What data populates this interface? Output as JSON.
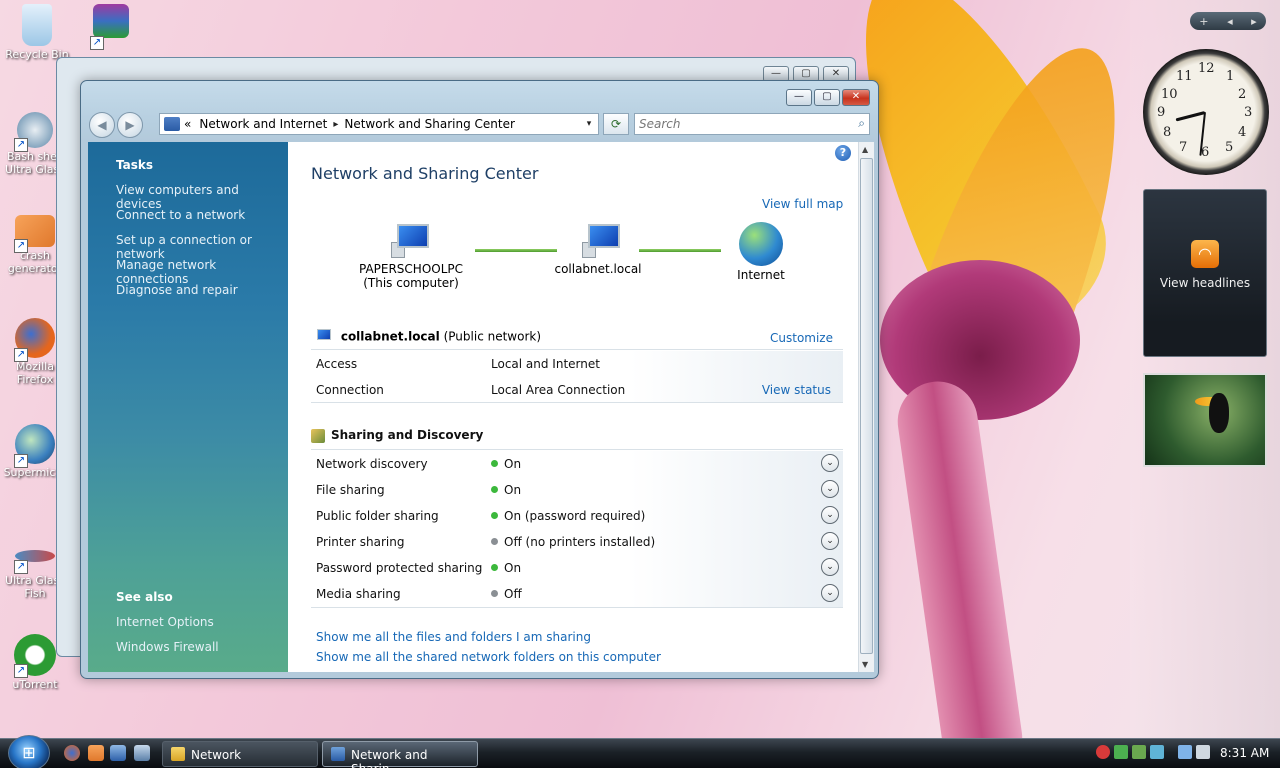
{
  "desktop": {
    "icons": [
      {
        "label": "Recycle Bin",
        "color": "#9cc7e6"
      },
      {
        "label": "",
        "color": "#7a2c7c"
      },
      {
        "label": "Bash shell Ultra Glass",
        "color": "#5b86a8"
      },
      {
        "label": "crash generator",
        "color": "#e0782c"
      },
      {
        "label": "Mozilla Firefox",
        "color": "#e5661d"
      },
      {
        "label": "Supermicro",
        "color": "#3a7fbf"
      },
      {
        "label": "Ultra Glass Fish",
        "color": "#4b8bc2"
      },
      {
        "label": "uTorrent",
        "color": "#2c9b34"
      }
    ]
  },
  "window": {
    "caption_buttons": {
      "minimize": "—",
      "maximize": "▢",
      "close": "✕"
    },
    "nav": {
      "back": "◀",
      "forward": "▶"
    },
    "address": {
      "prefix": "«",
      "segments": [
        "Network and Internet",
        "Network and Sharing Center"
      ],
      "separator": "▸",
      "dropdown": "▾",
      "refresh": "⟳"
    },
    "search": {
      "placeholder": "Search",
      "icon": "magnifier-icon",
      "glyph": "⌕"
    }
  },
  "sidebar": {
    "tasks_heading": "Tasks",
    "tasks": [
      "View computers and devices",
      "Connect to a network",
      "Set up a connection or network",
      "Manage network connections",
      "Diagnose and repair"
    ],
    "see_also_heading": "See also",
    "see_also": [
      "Internet Options",
      "Windows Firewall"
    ]
  },
  "main": {
    "help": "?",
    "title": "Network and Sharing Center",
    "view_full_map": "View full map",
    "map": {
      "computer": {
        "name": "PAPERSCHOOLPC",
        "sub": "(This computer)"
      },
      "network": {
        "name": "collabnet.local"
      },
      "internet": {
        "name": "Internet"
      }
    },
    "network": {
      "name": "collabnet.local",
      "type": "(Public network)",
      "customize": "Customize",
      "rows": [
        {
          "label": "Access",
          "value": "Local and Internet",
          "action": ""
        },
        {
          "label": "Connection",
          "value": "Local Area Connection",
          "action": "View status"
        }
      ]
    },
    "sharing": {
      "heading": "Sharing and Discovery",
      "expand_glyph": "⌄",
      "rows": [
        {
          "label": "Network discovery",
          "value": "On",
          "status": "on"
        },
        {
          "label": "File sharing",
          "value": "On",
          "status": "on"
        },
        {
          "label": "Public folder sharing",
          "value": "On (password required)",
          "status": "on"
        },
        {
          "label": "Printer sharing",
          "value": "Off (no printers installed)",
          "status": "off"
        },
        {
          "label": "Password protected sharing",
          "value": "On",
          "status": "on"
        },
        {
          "label": "Media sharing",
          "value": "Off",
          "status": "off"
        }
      ]
    },
    "links": [
      "Show me all the files and folders I am sharing",
      "Show me all the shared network folders on this computer"
    ]
  },
  "status_colors": {
    "on": "#3cb83c",
    "off": "#8a8f94"
  },
  "gadgets": {
    "toolbar": {
      "add": "+",
      "prev": "◂",
      "next": "▸"
    },
    "clock": {
      "time": "8:31",
      "numbers": [
        "12",
        "1",
        "2",
        "3",
        "4",
        "5",
        "6",
        "7",
        "8",
        "9",
        "10",
        "11"
      ]
    },
    "feed": {
      "label": "View headlines",
      "icon": "rss-icon"
    }
  },
  "taskbar": {
    "start_glyph": "⊞",
    "tasks": [
      {
        "label": "Network",
        "active": false
      },
      {
        "label": "Network and Sharin...",
        "active": true
      }
    ],
    "time": "8:31 AM"
  }
}
